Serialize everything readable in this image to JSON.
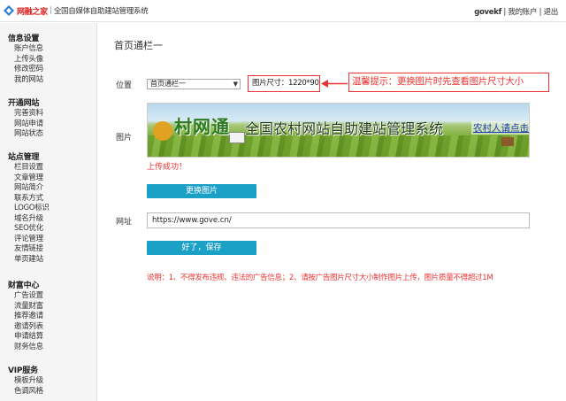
{
  "header": {
    "brand": "网融之家",
    "system_name": "全国自媒体自助建站管理系统",
    "username": "govekf",
    "separator": "|",
    "my_account": "我的账户",
    "logout": "退出"
  },
  "sidebar": {
    "groups": [
      {
        "title": "信息设置",
        "items": [
          "账户信息",
          "上传头像",
          "修改密码",
          "我的网站"
        ]
      },
      {
        "title": "开通网站",
        "items": [
          "完善资料",
          "网站申请",
          "网站状态"
        ]
      },
      {
        "title": "站点管理",
        "items": [
          "栏目设置",
          "文章管理",
          "网站简介",
          "联系方式",
          "LOGO标识",
          "域名升级",
          "SEO优化",
          "评论管理",
          "友情链接",
          "单页建站"
        ]
      },
      {
        "title": "财富中心",
        "items": [
          "广告设置",
          "流量财富",
          "推荐邀请",
          "邀请列表",
          "申请结算",
          "财务信息"
        ]
      },
      {
        "title": "VIP服务",
        "items": [
          "模板升级",
          "色调风格"
        ]
      }
    ]
  },
  "main": {
    "page_title": "首页通栏一",
    "position_label": "位置",
    "position_value": "首页通栏一",
    "size_text": "图片尺寸：1220*90",
    "tip_text": "温馨提示：更换图片时先查看图片尺寸大小",
    "image_label": "图片",
    "banner": {
      "brand": "村网通",
      "title": "全国农村网站自助建站管理系统",
      "link": "农村人请点击"
    },
    "upload_success": "上传成功！",
    "change_button": "更换图片",
    "url_label": "网址",
    "url_value": "https://www.gove.cn/",
    "save_button": "好了，保存",
    "note": "说明：1、不得发布违规、违法的广告信息；2、请按广告图片尺寸大小制作图片上传，图片质量不得超过1M"
  },
  "colors": {
    "accent": "#1ba0c6",
    "alert": "#ee3333",
    "brand_red": "#dd2222"
  }
}
